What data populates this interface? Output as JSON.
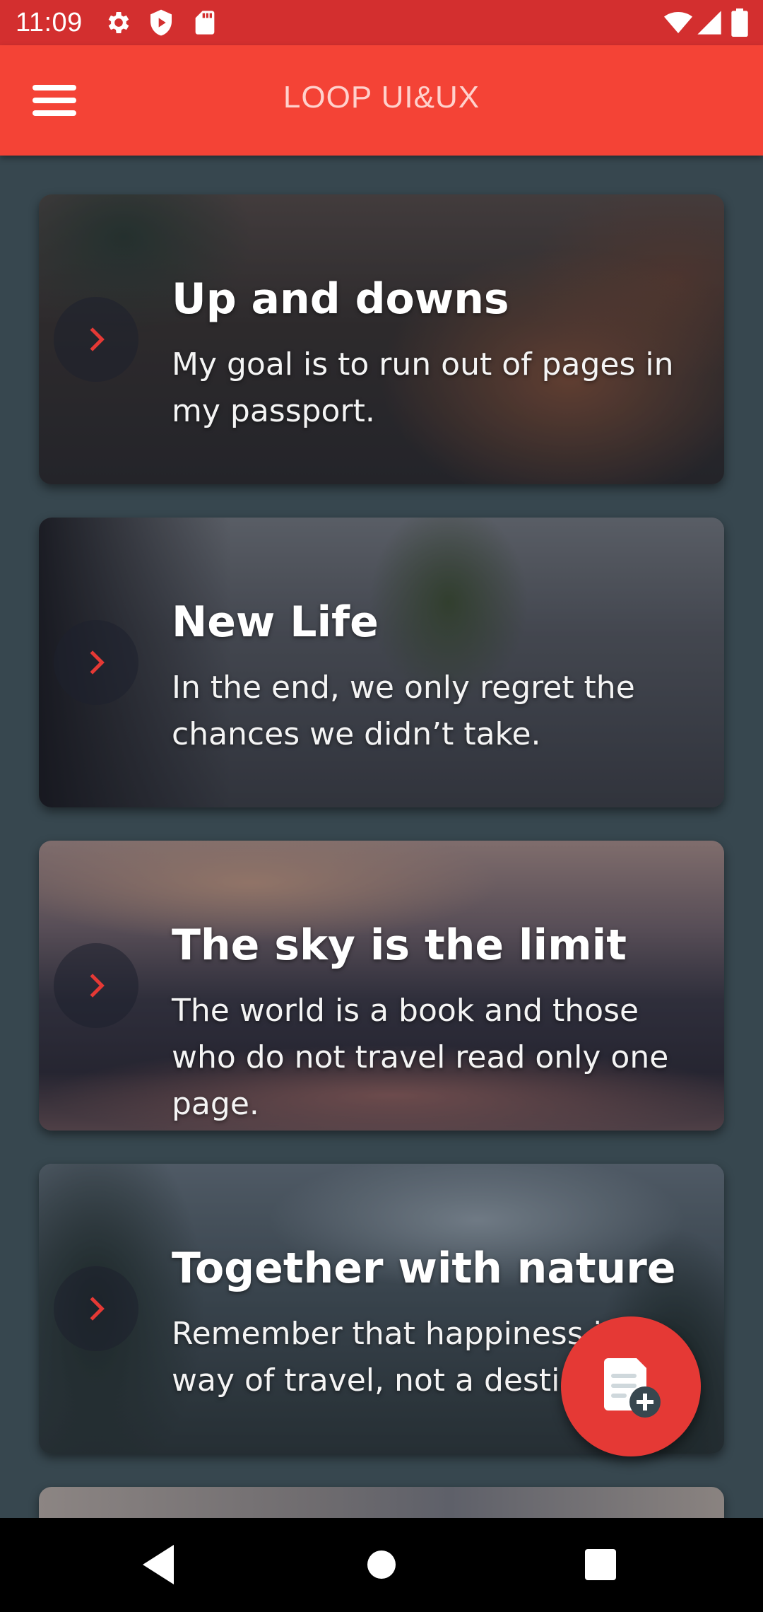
{
  "status_bar": {
    "time": "11:09",
    "left_icons": [
      "gear-icon",
      "play-shield-icon",
      "sd-card-icon"
    ],
    "right_icons": [
      "wifi-icon",
      "cellular-signal-icon",
      "battery-icon"
    ]
  },
  "app_bar": {
    "title": "LOOP UI&UX",
    "menu_icon": "hamburger-menu-icon",
    "color": "#f44336"
  },
  "cards": [
    {
      "title": "Up and downs",
      "subtitle": "My goal is to run out of pages in my passport."
    },
    {
      "title": "New Life",
      "subtitle": "In the end, we only regret the chances we didn’t take."
    },
    {
      "title": "The sky is the limit",
      "subtitle": "The world is a book and those who do not travel read only one page."
    },
    {
      "title": "Together with nature",
      "subtitle": "Remember that happiness is a way of travel, not a destination."
    }
  ],
  "card_action_icon": "chevron-right-icon",
  "fab": {
    "icon": "add-note-icon",
    "color": "#e53935"
  },
  "nav_bar": {
    "icons": [
      "back-icon",
      "home-icon",
      "recents-icon"
    ]
  },
  "colors": {
    "background": "#37474f",
    "status_bar": "#d32f2f",
    "accent": "#e53935"
  }
}
